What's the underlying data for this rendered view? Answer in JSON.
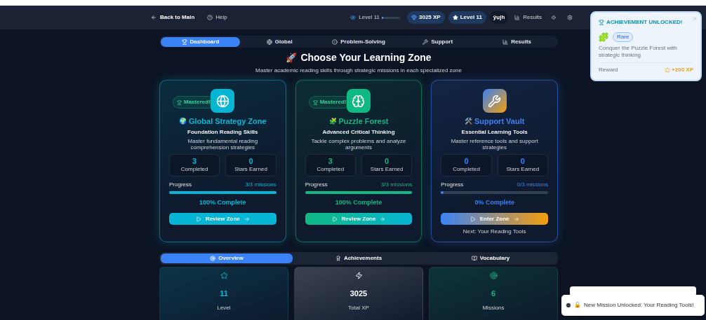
{
  "header": {
    "back": "Back to Main",
    "help": "Help",
    "level_label": "Level 11",
    "level_meter": {
      "level": 0.08
    },
    "xp": "3025 XP",
    "level_badge": "Level 11",
    "language": "ŷụjh",
    "results": "Results"
  },
  "tabs": [
    {
      "label": "Dashboard",
      "kind": "trophy",
      "selected": true
    },
    {
      "label": "Global",
      "kind": "globe",
      "selected": false
    },
    {
      "label": "Problem-Solving",
      "kind": "alert",
      "selected": false
    },
    {
      "label": "Support",
      "kind": "wrench",
      "selected": false
    },
    {
      "label": "Results",
      "kind": "chart",
      "selected": false
    }
  ],
  "heading": {
    "emoji": "🚀",
    "title": "Choose Your Learning Zone",
    "subtitle": "Master academic reading skills through strategic missions in each specialized zone"
  },
  "zones": [
    {
      "kind": "globe",
      "color": "#06b6d4",
      "mastered": true,
      "mastered_label": "Mastered!",
      "emoji": "🌍",
      "name": "Global Strategy Zone",
      "subtitle": "Foundation Reading Skills",
      "description": "Master fundamental reading comprehension strategies",
      "completed": "3",
      "completed_label": "Completed",
      "stars": "0",
      "stars_label": "Stars Earned",
      "progress_label": "Progress",
      "missions": "3/3 missions",
      "progress": {
        "level": 1
      },
      "percent": "100% Complete",
      "button": "Review Zone"
    },
    {
      "kind": "brain",
      "color": "#10b981",
      "mastered": true,
      "mastered_label": "Mastered!",
      "emoji": "🧩",
      "name": "Puzzle Forest",
      "subtitle": "Advanced Critical Thinking",
      "description": "Tackle complex problems and analyze arguments",
      "completed": "3",
      "completed_label": "Completed",
      "stars": "0",
      "stars_label": "Stars Earned",
      "progress_label": "Progress",
      "missions": "3/3 missions",
      "progress": {
        "level": 1
      },
      "percent": "100% Complete",
      "button": "Review Zone"
    },
    {
      "kind": "wrench",
      "color": "#3b82f6",
      "mastered": false,
      "emoji": "🛠️",
      "name": "Support Vault",
      "subtitle": "Essential Learning Tools",
      "description": "Master reference tools and support strategies",
      "completed": "0",
      "completed_label": "Completed",
      "stars": "0",
      "stars_label": "Stars Earned",
      "progress_label": "Progress",
      "missions": "0/3 missions",
      "progress": {
        "level": 0
      },
      "percent": "0% Complete",
      "button": "Enter Zone",
      "note": "Next: Your Reading Tools"
    }
  ],
  "bottom_tabs": [
    {
      "label": "Overview",
      "kind": "target",
      "selected": true
    },
    {
      "label": "Achievements",
      "kind": "award",
      "selected": false
    },
    {
      "label": "Vocabulary",
      "kind": "book",
      "selected": false
    }
  ],
  "stats": [
    {
      "kind": "star",
      "color": "#06b6d4",
      "value": "11",
      "label": "Level"
    },
    {
      "kind": "zap",
      "color": "#ffffff",
      "value": "3025",
      "label": "Total XP"
    },
    {
      "kind": "target",
      "color": "#10b981",
      "value": "6",
      "label": "Missions"
    }
  ],
  "achievement": {
    "title": "ACHIEVEMENT UNLOCKED!",
    "badge": "Rare",
    "description": "Conquer the Puzzle Forest with strategic thinking",
    "reward_label": "Reward",
    "reward": "+200 XP"
  },
  "toast": {
    "emoji": "🔓",
    "text": "New Mission Unlocked: Your Reading Tools!"
  }
}
